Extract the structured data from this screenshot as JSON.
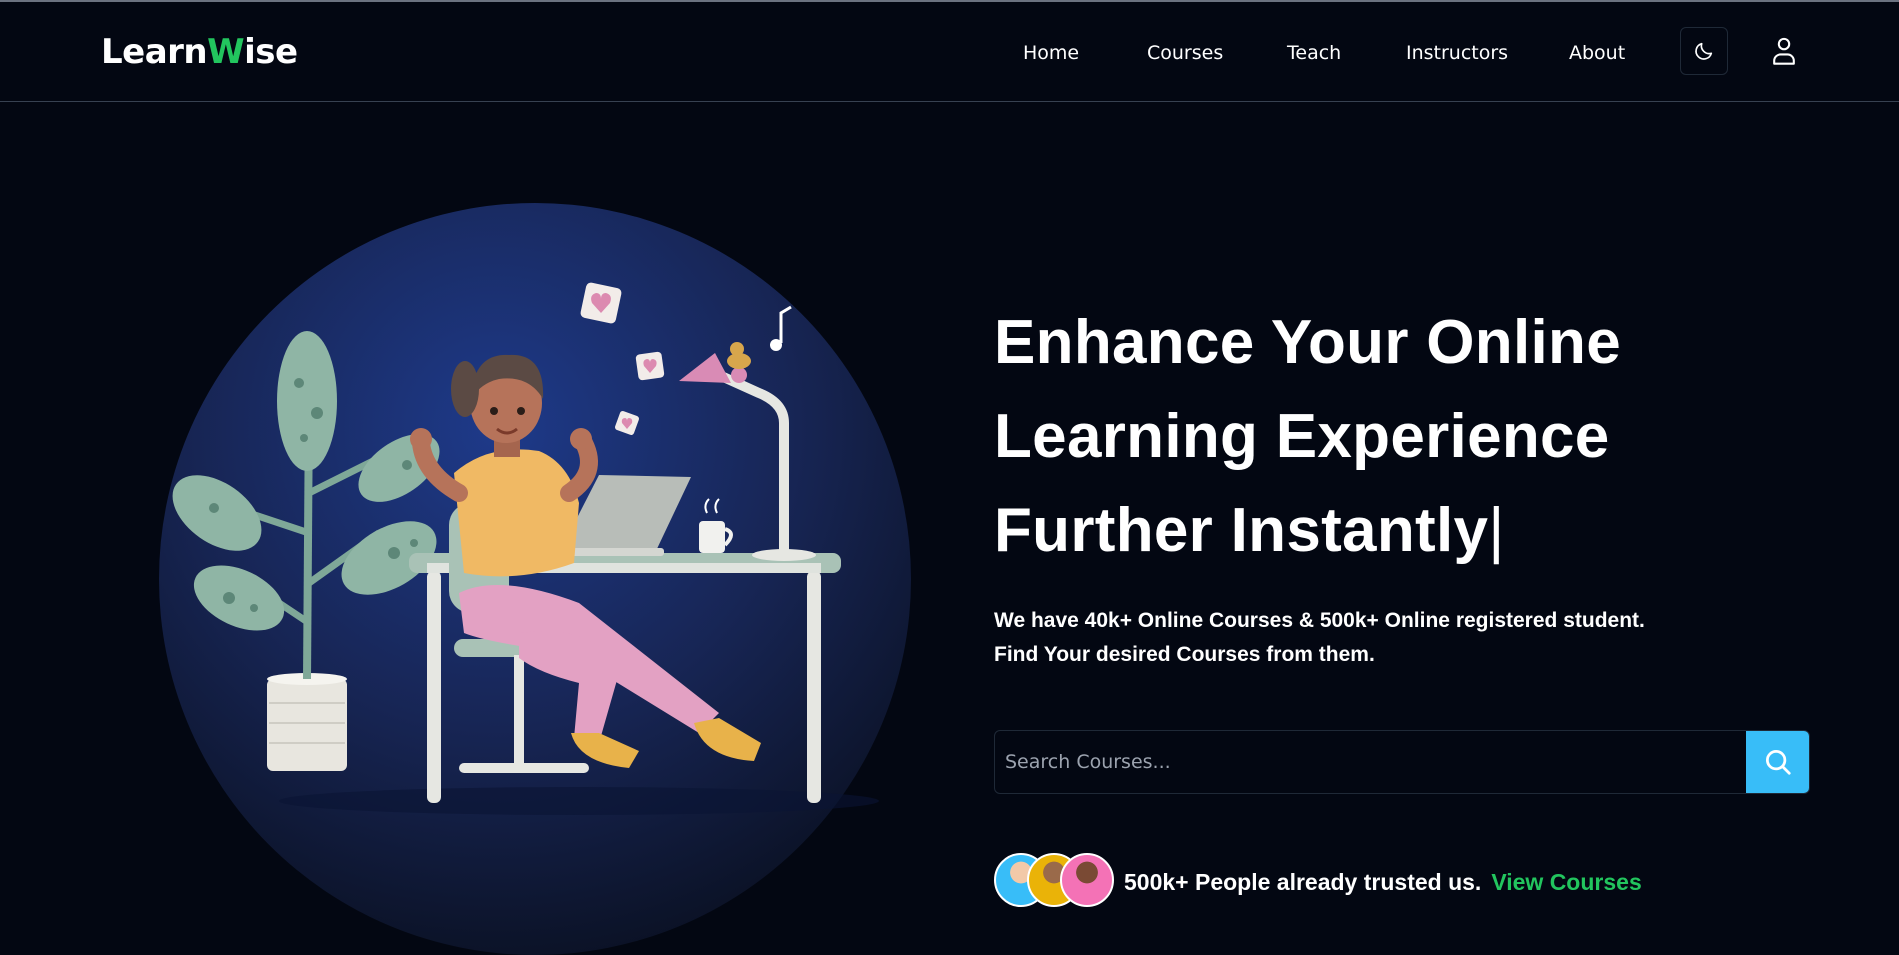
{
  "brand": {
    "name_part1": "Learn",
    "name_part2": "W",
    "name_part3": "ise",
    "accent_color": "#22c55e"
  },
  "nav": {
    "items": [
      {
        "label": "Home"
      },
      {
        "label": "Courses"
      },
      {
        "label": "Teach"
      },
      {
        "label": "Instructors"
      },
      {
        "label": "About"
      }
    ],
    "theme_toggle_icon": "moon-icon",
    "user_icon": "user-icon"
  },
  "hero": {
    "headline_line1": "Enhance Your Online",
    "headline_line2": "Learning Experience",
    "headline_line3": "Further Instantly",
    "caret": "|",
    "subtext_line1": "We have 40k+ Online Courses & 500k+ Online registered student.",
    "subtext_line2": "Find Your desired Courses from them.",
    "illustration": "student-at-desk-illustration"
  },
  "search": {
    "placeholder": "Search Courses...",
    "value": "",
    "button_icon": "search-icon",
    "button_color": "#38bdf8"
  },
  "trust": {
    "text": "500k+ People already trusted us.",
    "link_label": "View Courses",
    "avatars": [
      "student-avatar",
      "student-avatar",
      "student-avatar"
    ]
  },
  "colors": {
    "background": "#030712",
    "link_green": "#22c55e"
  }
}
